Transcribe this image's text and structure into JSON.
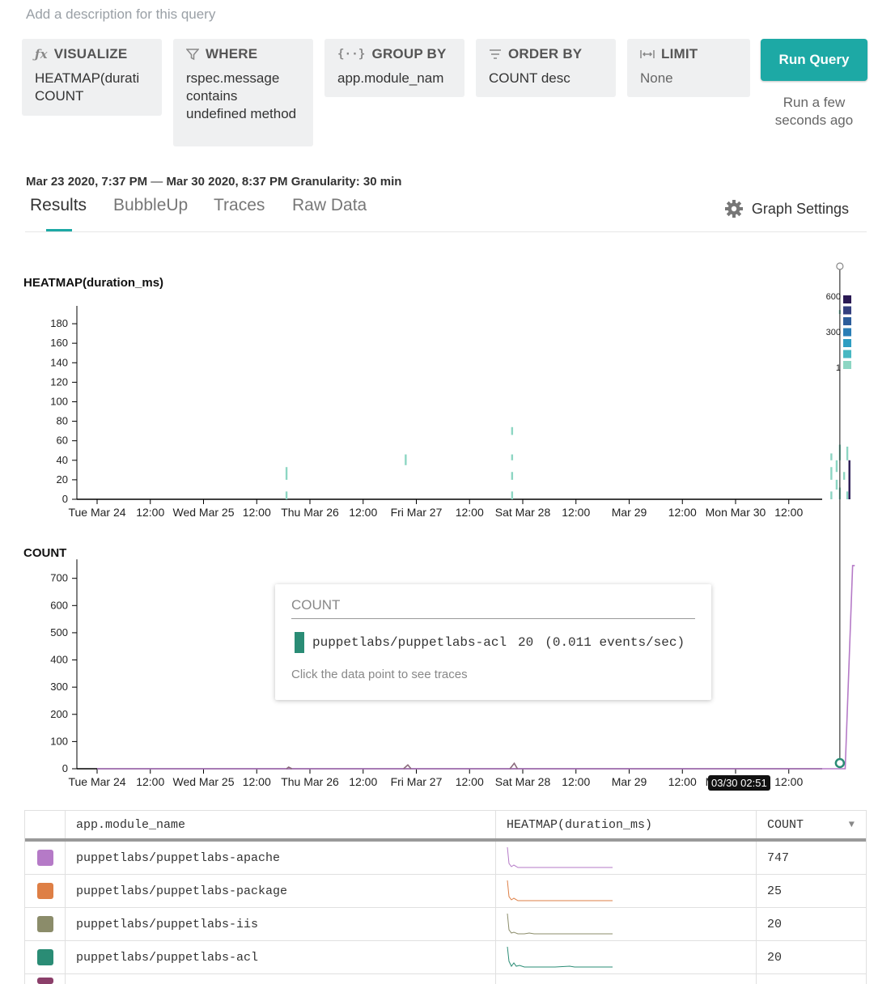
{
  "description_placeholder": "Add a description for this query",
  "query": {
    "visualize": {
      "label": "VISUALIZE",
      "values": [
        "HEATMAP(durati",
        "COUNT"
      ]
    },
    "where": {
      "label": "WHERE",
      "value": "rspec.message contains undefined method"
    },
    "group_by": {
      "label": "GROUP BY",
      "value": "app.module_nam"
    },
    "order_by": {
      "label": "ORDER BY",
      "value": "COUNT desc"
    },
    "limit": {
      "label": "LIMIT",
      "value": "None"
    }
  },
  "run": {
    "label": "Run Query",
    "note": "Run a few seconds ago"
  },
  "time_range": {
    "start": "Mar 23 2020, 7:37 PM",
    "sep": "—",
    "end": "Mar 30 2020, 8:37 PM",
    "granularity": "Granularity: 30 min"
  },
  "tabs": [
    "Results",
    "BubbleUp",
    "Traces",
    "Raw Data"
  ],
  "graph_settings": "Graph Settings",
  "colors": {
    "accent": "#1da9a5",
    "apache": "#b57ac7",
    "package": "#de7f45",
    "iis": "#8b8c6a",
    "acl": "#2a8c75"
  },
  "chart_data": [
    {
      "type": "heatmap",
      "title": "HEATMAP(duration_ms)",
      "x_ticks": [
        "Tue Mar 24",
        "12:00",
        "Wed Mar 25",
        "12:00",
        "Thu Mar 26",
        "12:00",
        "Fri Mar 27",
        "12:00",
        "Sat Mar 28",
        "12:00",
        "Mar 29",
        "12:00",
        "Mon Mar 30",
        "12:00"
      ],
      "y_ticks": [
        0,
        20,
        40,
        60,
        80,
        100,
        120,
        140,
        160,
        180
      ],
      "ylim": [
        0,
        190
      ],
      "legend": {
        "labels": [
          "600",
          "300",
          "1"
        ],
        "placement": "top-right",
        "colors": [
          "#2b1a54",
          "#34407f",
          "#2c5d9b",
          "#2a7eb6",
          "#2e9ec2",
          "#48b8c2",
          "#8dd6c3"
        ]
      },
      "cells": [
        {
          "t": 1.78,
          "y0": 0,
          "y1": 8
        },
        {
          "t": 1.78,
          "y0": 20,
          "y1": 33
        },
        {
          "t": 2.9,
          "y0": 35,
          "y1": 46
        },
        {
          "t": 3.9,
          "y0": 0,
          "y1": 8
        },
        {
          "t": 3.9,
          "y0": 20,
          "y1": 28
        },
        {
          "t": 3.9,
          "y0": 40,
          "y1": 46
        },
        {
          "t": 3.9,
          "y0": 66,
          "y1": 74
        },
        {
          "t": 6.9,
          "y0": 0,
          "y1": 8
        },
        {
          "t": 6.9,
          "y0": 20,
          "y1": 33
        },
        {
          "t": 6.9,
          "y0": 40,
          "y1": 47
        },
        {
          "t": 6.95,
          "y0": 10,
          "y1": 20
        },
        {
          "t": 6.95,
          "y0": 28,
          "y1": 40
        },
        {
          "t": 6.98,
          "y0": 0,
          "y1": 12
        },
        {
          "t": 6.98,
          "y0": 40,
          "y1": 56
        },
        {
          "t": 7.02,
          "y0": 20,
          "y1": 28
        },
        {
          "t": 7.05,
          "y0": 0,
          "y1": 8
        },
        {
          "t": 7.05,
          "y0": 40,
          "y1": 54
        },
        {
          "t": 7.07,
          "y0": 0,
          "y1": 40
        },
        {
          "t": 6.98,
          "y0": 190,
          "y1": 194
        }
      ]
    },
    {
      "type": "line",
      "title": "COUNT",
      "x_ticks": [
        "Tue Mar 24",
        "12:00",
        "Wed Mar 25",
        "12:00",
        "Thu Mar 26",
        "12:00",
        "Fri Mar 27",
        "12:00",
        "Sat Mar 28",
        "12:00",
        "Mar 29",
        "12:00",
        "Mon Mar 30",
        "12:00"
      ],
      "y_ticks": [
        0,
        100,
        200,
        300,
        400,
        500,
        600,
        700
      ],
      "ylim": [
        0,
        740
      ],
      "series": [
        {
          "color": "#b57ac7",
          "points": [
            [
              0,
              0
            ],
            [
              7.0,
              0
            ],
            [
              7.03,
              0
            ],
            [
              7.1,
              747
            ],
            [
              7.12,
              747
            ]
          ]
        },
        {
          "color": "#8b6a7c",
          "points": [
            [
              1.78,
              0
            ],
            [
              1.8,
              6
            ],
            [
              1.83,
              0
            ]
          ]
        },
        {
          "color": "#8b6a7c",
          "points": [
            [
              2.88,
              0
            ],
            [
              2.92,
              14
            ],
            [
              2.95,
              0
            ]
          ]
        },
        {
          "color": "#8b6a7c",
          "points": [
            [
              3.88,
              0
            ],
            [
              3.92,
              20
            ],
            [
              3.95,
              0
            ]
          ]
        }
      ],
      "hover_t": 6.98,
      "hover_label": "03/30 02:51"
    }
  ],
  "tooltip": {
    "title": "COUNT",
    "name": "puppetlabs/puppetlabs-acl",
    "count": "20",
    "rate": "(0.011 events/sec)",
    "note": "Click the data point to see traces"
  },
  "table": {
    "headers": [
      "app.module_name",
      "HEATMAP(duration_ms)",
      "COUNT"
    ],
    "rows": [
      {
        "name": "puppetlabs/puppetlabs-apache",
        "count": "747",
        "color": "#b57ac7"
      },
      {
        "name": "puppetlabs/puppetlabs-package",
        "count": "25",
        "color": "#de7f45"
      },
      {
        "name": "puppetlabs/puppetlabs-iis",
        "count": "20",
        "color": "#8b8c6a"
      },
      {
        "name": "puppetlabs/puppetlabs-acl",
        "count": "20",
        "color": "#2a8c75"
      }
    ]
  }
}
